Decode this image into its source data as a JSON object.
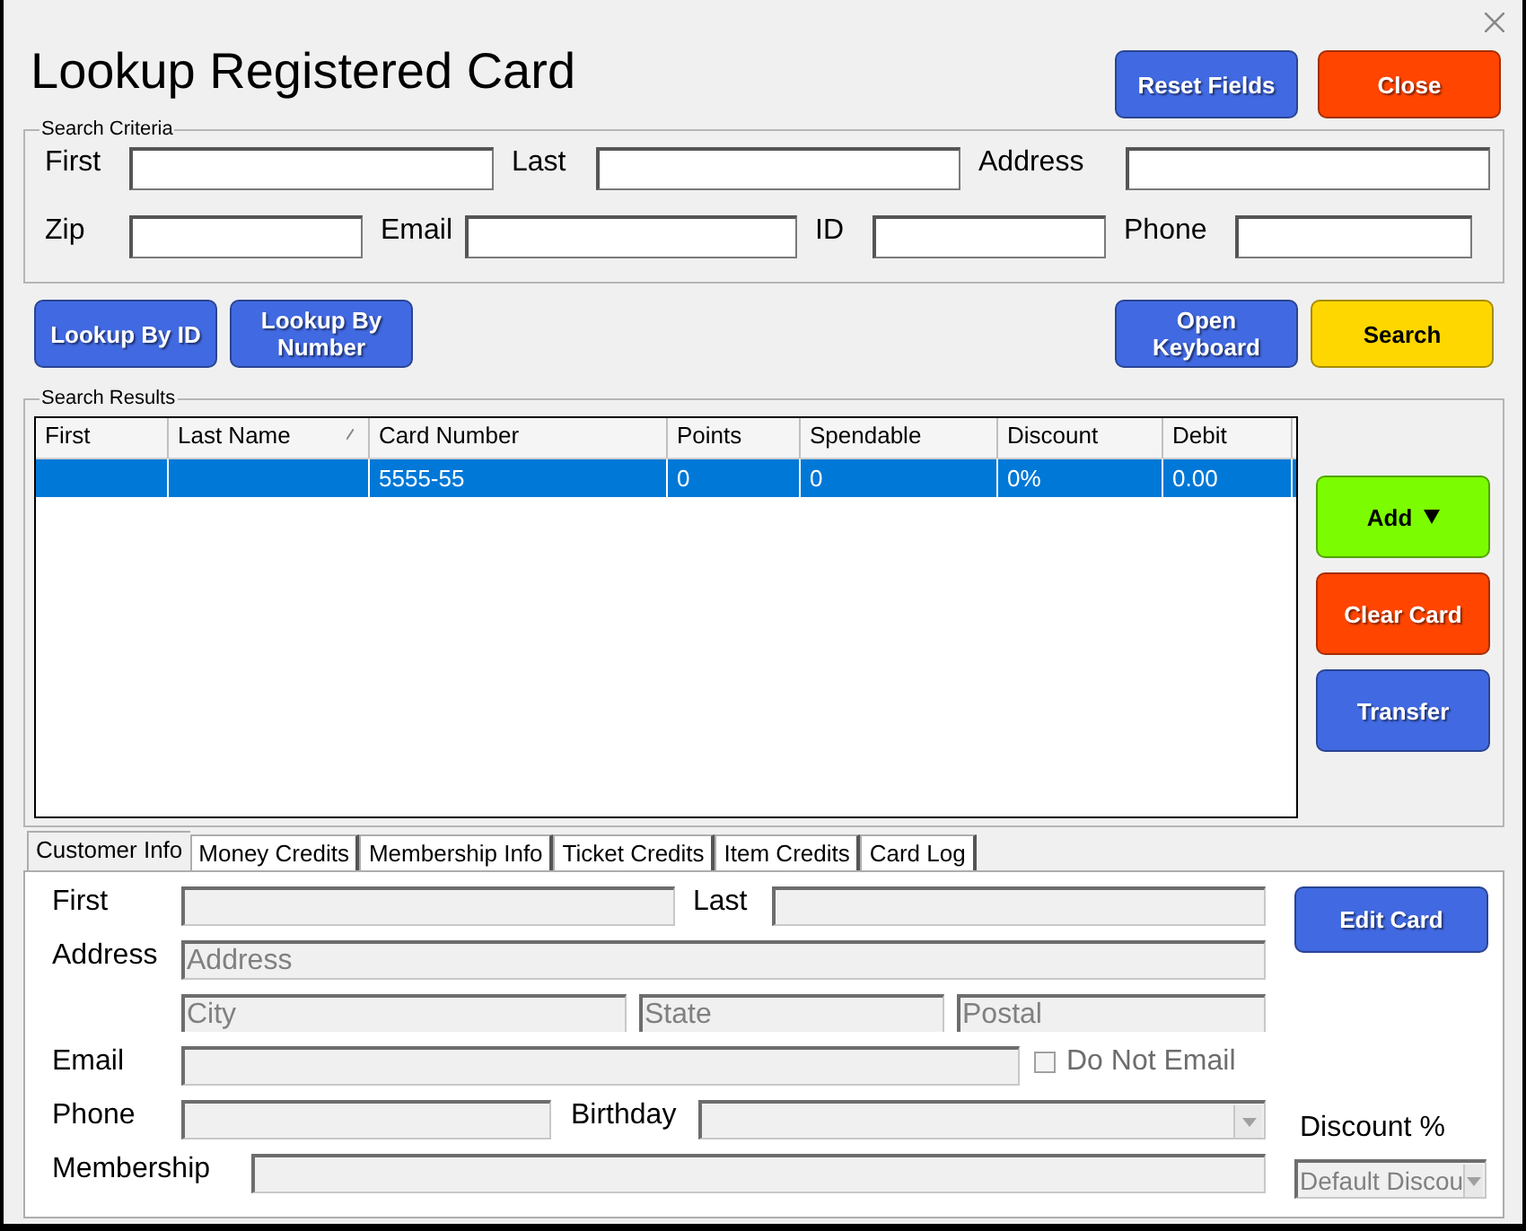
{
  "window": {
    "title": "Lookup Registered Card"
  },
  "header_buttons": [
    {
      "label": "Reset Fields",
      "color": "#4169e1"
    },
    {
      "label": "Close",
      "color": "#ff4500"
    }
  ],
  "search_criteria": {
    "title": "Search Criteria",
    "rows": [
      [
        {
          "label": "First"
        },
        {
          "label": "Last"
        },
        {
          "label": "Address"
        }
      ],
      [
        {
          "label": "Zip"
        },
        {
          "label": "Email"
        },
        {
          "label": "ID"
        },
        {
          "label": "Phone"
        }
      ]
    ]
  },
  "lookup_buttons": [
    {
      "label": "Lookup By ID",
      "color": "#4169e1"
    },
    {
      "label": "Lookup By Number",
      "color": "#4169e1"
    }
  ],
  "search_buttons": [
    {
      "label": "Open Keyboard",
      "color": "#4169e1"
    },
    {
      "label": "Search",
      "color": "#ffd700"
    }
  ],
  "search_results": {
    "title": "Search Results",
    "columns": [
      {
        "label": "First",
        "sorted": false
      },
      {
        "label": "Last Name",
        "sorted": true
      },
      {
        "label": "Card Number",
        "sorted": false
      },
      {
        "label": "Points",
        "sorted": false
      },
      {
        "label": "Spendable",
        "sorted": false
      },
      {
        "label": "Discount",
        "sorted": false
      },
      {
        "label": "Debit",
        "sorted": false
      }
    ],
    "rows": [
      {
        "cells": [
          "",
          "",
          "5555-55",
          "0",
          "0",
          "0%",
          "0.00"
        ],
        "selected": true
      }
    ]
  },
  "side_buttons": [
    {
      "label": "Add",
      "color": "#7cfc00",
      "dropdown": true
    },
    {
      "label": "Clear Card",
      "color": "#ff4500",
      "dropdown": false
    },
    {
      "label": "Transfer",
      "color": "#4169e1",
      "dropdown": false
    }
  ],
  "tabs": [
    {
      "label": "Customer Info",
      "selected": true
    },
    {
      "label": "Money Credits",
      "selected": false
    },
    {
      "label": "Membership Info",
      "selected": false
    },
    {
      "label": "Ticket Credits",
      "selected": false
    },
    {
      "label": "Item Credits",
      "selected": false
    },
    {
      "label": "Card Log",
      "selected": false
    }
  ],
  "customer_info": {
    "first_label": "First",
    "last_label": "Last",
    "address_label": "Address",
    "address_placeholder": "Address",
    "city_placeholder": "City",
    "state_placeholder": "State",
    "postal_placeholder": "Postal",
    "email_label": "Email",
    "do_not_email": {
      "label": "Do Not Email",
      "checked": false
    },
    "phone_label": "Phone",
    "birthday_label": "Birthday",
    "membership_label": "Membership",
    "edit_button": {
      "label": "Edit Card",
      "color": "#4169e1"
    },
    "discount_label": "Discount %",
    "discount_value": "Default Discou"
  }
}
